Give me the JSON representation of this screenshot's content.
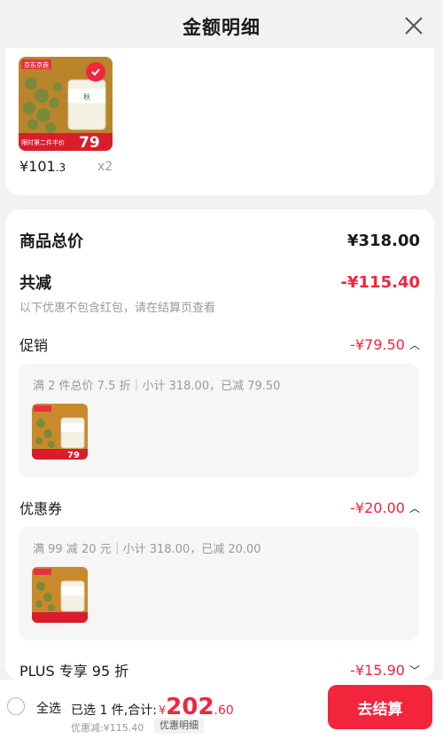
{
  "header": {
    "title": "金额明细",
    "close_icon": "close-icon"
  },
  "product": {
    "image_badge": "京东京造",
    "image_tag": "限时第二件半价",
    "image_price": "79",
    "price_int": "¥101",
    "price_dec": ".3",
    "qty": "x2",
    "selected": true
  },
  "summary": {
    "goods_total_label": "商品总价",
    "goods_total_value": "¥318.00",
    "reduce_label": "共减",
    "reduce_value": "-¥115.40",
    "reduce_note": "以下优惠不包含红包，请在结算页查看"
  },
  "promotion": {
    "label": "促销",
    "value": "-¥79.50",
    "desc": "满 2 件总价 7.5 折｜小计 318.00，已减 79.50"
  },
  "coupon": {
    "label": "优惠券",
    "value": "-¥20.00",
    "desc": "满 99 减 20 元｜小计 318.00，已减 20.00"
  },
  "plus": {
    "label": "PLUS 专享 95 折",
    "value": "-¥15.90"
  },
  "footer": {
    "select_all": "全选",
    "selected_text": "已选 1 件,合计:",
    "total_yen": "¥",
    "total_int": "202",
    "total_dec": ".60",
    "saved_text": "优惠减:¥115.40",
    "detail_label": "优惠明细",
    "checkout_label": "去结算"
  },
  "colors": {
    "accent": "#f2253d",
    "muted": "#999999",
    "bg": "#f2f2f2"
  }
}
